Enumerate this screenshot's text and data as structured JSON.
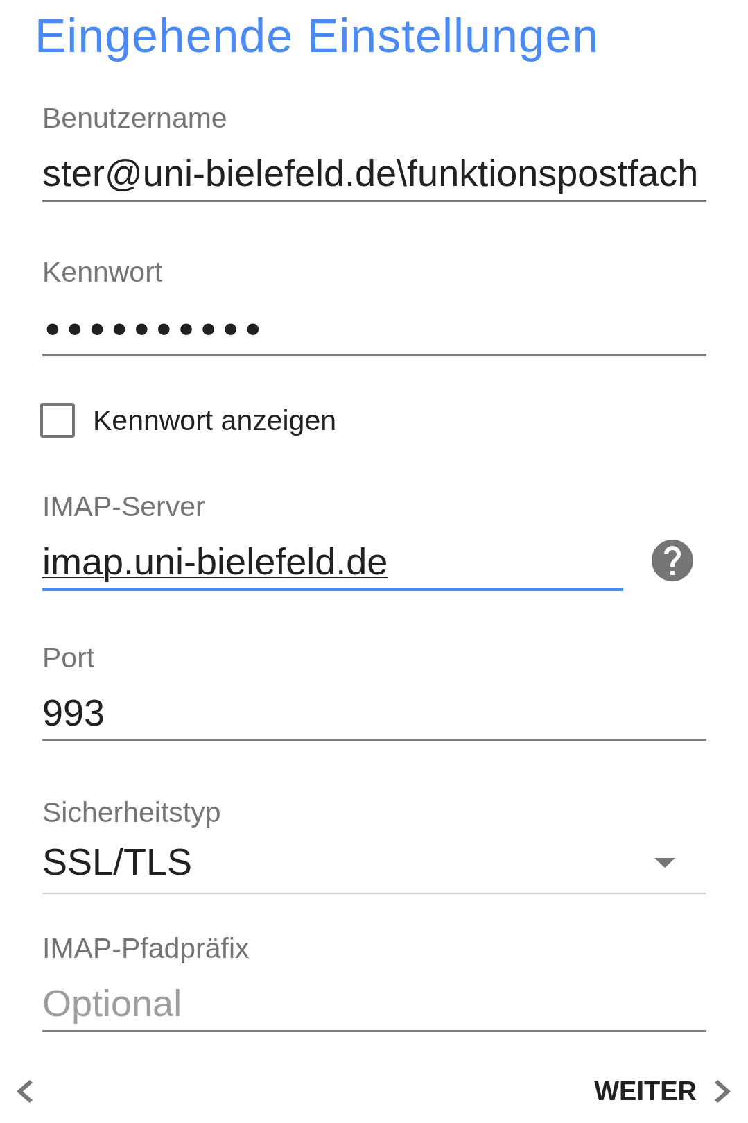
{
  "title": "Eingehende Einstellungen",
  "fields": [
    {
      "kind": "text",
      "label": "Benutzername",
      "value": "ster@uni-bielefeld.de\\funktionspostfach",
      "focused": false,
      "help_button": false
    },
    {
      "kind": "password",
      "label": "Kennwort",
      "value": "••••••••••",
      "focused": false,
      "help_button": false
    },
    {
      "kind": "checkbox",
      "label": "Kennwort anzeigen",
      "checked": false
    },
    {
      "kind": "text",
      "label": "IMAP-Server",
      "value": "imap.uni-bielefeld.de",
      "focused": true,
      "help_button": true
    },
    {
      "kind": "text",
      "label": "Port",
      "value": "993",
      "focused": false,
      "help_button": false
    },
    {
      "kind": "dropdown",
      "label": "Sicherheitstyp",
      "value": "SSL/TLS"
    },
    {
      "kind": "text",
      "label": "IMAP-Pfadpräfix",
      "placeholder": "Optional",
      "focused": false,
      "help_button": false
    }
  ],
  "navigation": {
    "next": "WEITER"
  }
}
